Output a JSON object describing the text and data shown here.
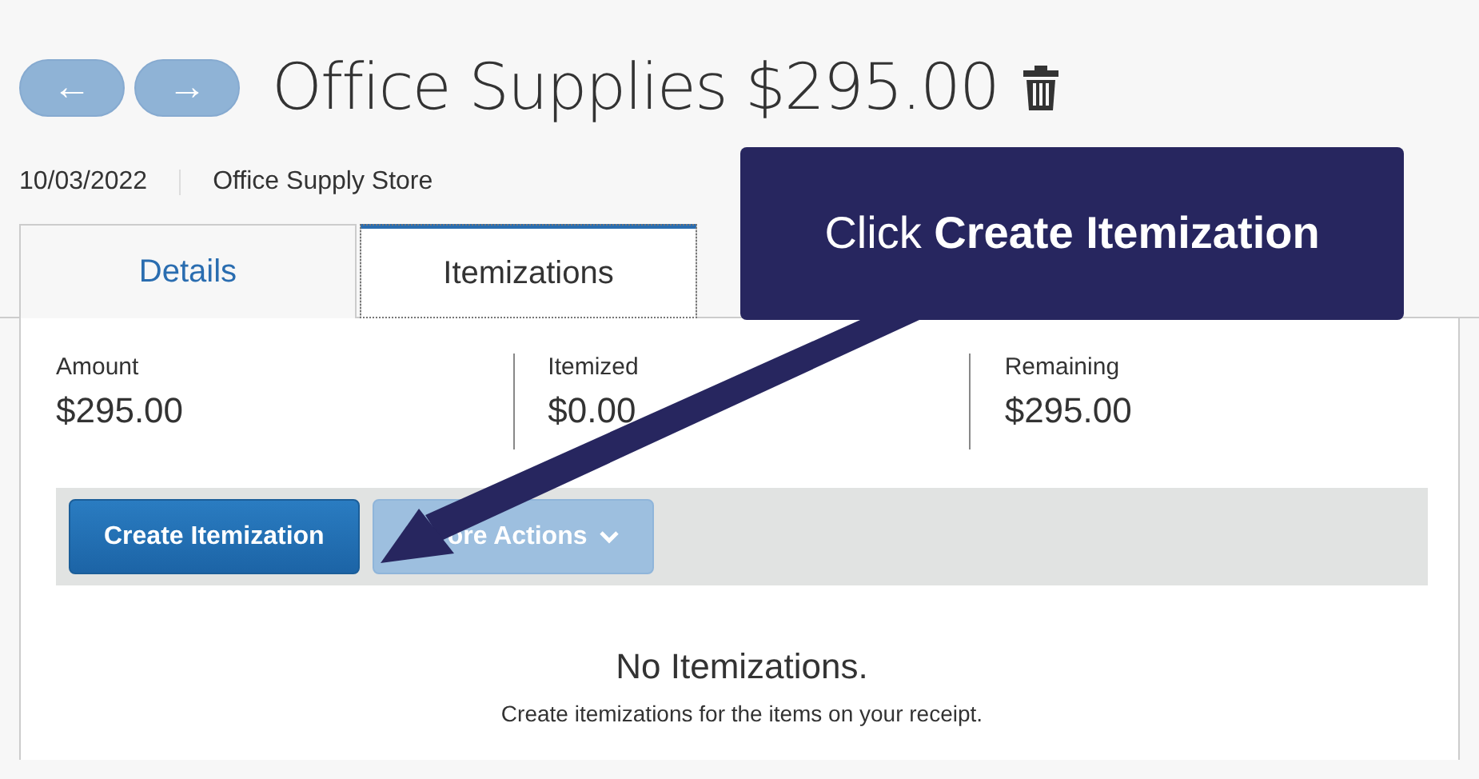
{
  "nav_buttons": [
    {
      "label": "←"
    },
    {
      "label": "→"
    }
  ],
  "title": "Office Supplies $295.00",
  "meta": {
    "date": "10/03/2022",
    "vendor": "Office Supply Store"
  },
  "tabs": [
    {
      "label": "Details",
      "selected": false
    },
    {
      "label": "Itemizations",
      "selected": true
    }
  ],
  "summary": [
    {
      "label": "Amount",
      "value": "$295.00"
    },
    {
      "label": "Itemized",
      "value": "$0.00"
    },
    {
      "label": "Remaining",
      "value": "$295.00"
    }
  ],
  "actions": [
    {
      "label": "Create Itemization",
      "disabled": false,
      "dropdown": false
    },
    {
      "label": "ore Actions",
      "disabled": true,
      "dropdown": true
    }
  ],
  "empty_state": {
    "title": "No Itemizations.",
    "message": "Create itemizations for the items on your receipt."
  },
  "callout": {
    "text": "Click **Create Itemization**"
  }
}
